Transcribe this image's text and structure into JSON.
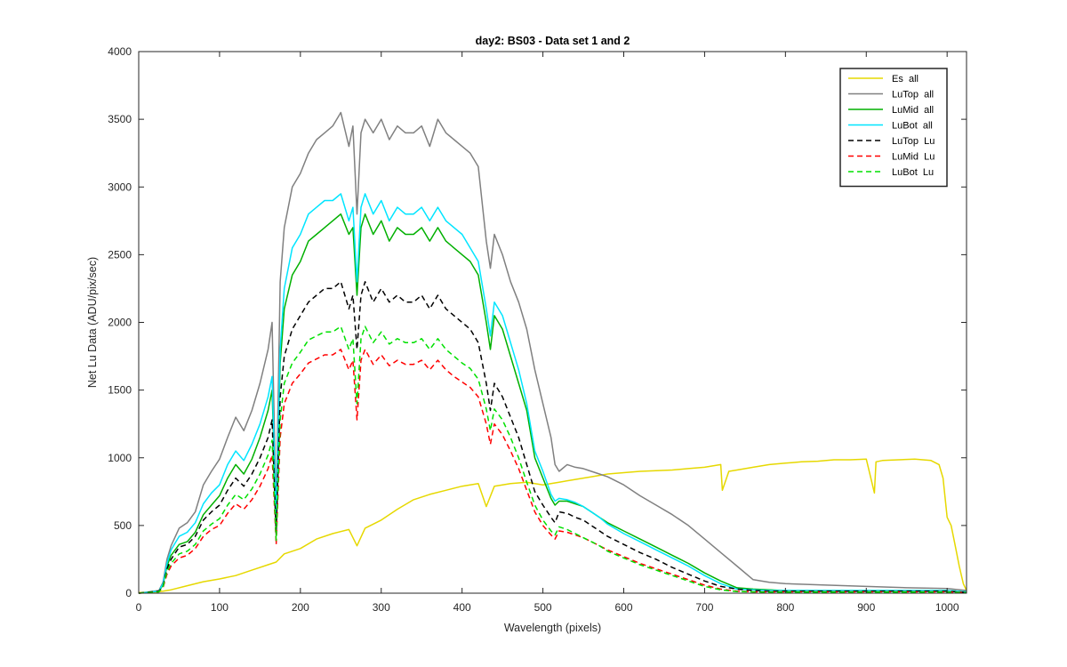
{
  "chart_data": {
    "type": "line",
    "title": "day2: BS03 - Data set 1 and 2",
    "xlabel": "Wavelength (pixels)",
    "ylabel": "Net Lu Data (ADU/pix/sec)",
    "xlim": [
      0,
      1024
    ],
    "ylim": [
      0,
      4000
    ],
    "xticks": [
      0,
      100,
      200,
      300,
      400,
      500,
      600,
      700,
      800,
      900,
      1000
    ],
    "yticks": [
      0,
      500,
      1000,
      1500,
      2000,
      2500,
      3000,
      3500,
      4000
    ],
    "grid": false,
    "legend_position": "top-right",
    "series": [
      {
        "name": "Es  all",
        "color": "#E6D800",
        "dash": "solid",
        "x": [
          0,
          20,
          30,
          40,
          60,
          80,
          100,
          120,
          140,
          160,
          170,
          180,
          200,
          220,
          240,
          260,
          270,
          280,
          300,
          320,
          340,
          360,
          380,
          400,
          420,
          430,
          440,
          460,
          480,
          500,
          520,
          540,
          560,
          580,
          600,
          620,
          640,
          660,
          680,
          700,
          720,
          722,
          730,
          740,
          760,
          780,
          800,
          820,
          840,
          860,
          880,
          900,
          910,
          912,
          920,
          940,
          960,
          980,
          990,
          995,
          1000,
          1005,
          1010,
          1015,
          1020,
          1024
        ],
        "y": [
          5,
          8,
          15,
          25,
          55,
          85,
          105,
          130,
          170,
          210,
          230,
          290,
          330,
          400,
          440,
          470,
          350,
          480,
          540,
          620,
          690,
          730,
          760,
          790,
          810,
          640,
          790,
          810,
          820,
          800,
          820,
          840,
          860,
          880,
          890,
          900,
          905,
          910,
          920,
          930,
          950,
          760,
          900,
          910,
          930,
          950,
          960,
          970,
          975,
          985,
          985,
          990,
          740,
          970,
          980,
          985,
          990,
          980,
          950,
          850,
          560,
          500,
          350,
          200,
          70,
          20
        ]
      },
      {
        "name": "LuTop  all",
        "color": "#808080",
        "dash": "solid",
        "x": [
          0,
          25,
          30,
          35,
          40,
          50,
          60,
          70,
          80,
          90,
          100,
          110,
          120,
          130,
          140,
          150,
          160,
          165,
          170,
          175,
          180,
          190,
          200,
          210,
          220,
          230,
          240,
          250,
          260,
          265,
          270,
          275,
          280,
          290,
          300,
          310,
          320,
          330,
          340,
          350,
          360,
          370,
          380,
          390,
          400,
          410,
          420,
          430,
          435,
          440,
          450,
          460,
          470,
          480,
          490,
          500,
          510,
          515,
          520,
          530,
          540,
          550,
          560,
          570,
          580,
          600,
          620,
          640,
          660,
          680,
          700,
          720,
          740,
          760,
          780,
          800,
          850,
          900,
          950,
          1000,
          1024
        ],
        "y": [
          0,
          20,
          80,
          250,
          350,
          480,
          520,
          600,
          800,
          900,
          990,
          1150,
          1300,
          1200,
          1350,
          1550,
          1800,
          2000,
          600,
          2300,
          2700,
          3000,
          3100,
          3250,
          3350,
          3400,
          3450,
          3550,
          3300,
          3450,
          2800,
          3400,
          3500,
          3400,
          3500,
          3350,
          3450,
          3400,
          3400,
          3450,
          3300,
          3500,
          3400,
          3350,
          3300,
          3250,
          3150,
          2600,
          2400,
          2650,
          2500,
          2300,
          2150,
          1950,
          1650,
          1400,
          1150,
          950,
          900,
          950,
          930,
          920,
          900,
          880,
          860,
          800,
          720,
          650,
          580,
          500,
          400,
          300,
          200,
          100,
          80,
          70,
          60,
          50,
          40,
          35,
          20
        ]
      },
      {
        "name": "LuMid  all",
        "color": "#00B000",
        "dash": "solid",
        "x": [
          0,
          25,
          30,
          35,
          40,
          50,
          60,
          70,
          80,
          90,
          100,
          110,
          120,
          130,
          140,
          150,
          160,
          165,
          170,
          175,
          180,
          190,
          200,
          210,
          220,
          230,
          240,
          250,
          260,
          265,
          270,
          275,
          280,
          290,
          300,
          310,
          320,
          330,
          340,
          350,
          360,
          370,
          380,
          390,
          400,
          410,
          420,
          430,
          435,
          440,
          450,
          460,
          470,
          480,
          490,
          500,
          510,
          515,
          520,
          530,
          540,
          550,
          560,
          570,
          580,
          600,
          620,
          640,
          660,
          680,
          700,
          720,
          740,
          760,
          780,
          800,
          850,
          900,
          950,
          1000,
          1024
        ],
        "y": [
          0,
          15,
          60,
          200,
          280,
          360,
          380,
          450,
          580,
          650,
          720,
          850,
          950,
          880,
          990,
          1150,
          1350,
          1500,
          500,
          1700,
          2100,
          2350,
          2450,
          2600,
          2650,
          2700,
          2750,
          2800,
          2650,
          2700,
          2200,
          2700,
          2800,
          2650,
          2750,
          2600,
          2700,
          2650,
          2650,
          2700,
          2600,
          2700,
          2600,
          2550,
          2500,
          2450,
          2350,
          2000,
          1800,
          2050,
          1950,
          1750,
          1550,
          1350,
          1000,
          850,
          700,
          650,
          680,
          680,
          660,
          640,
          600,
          560,
          520,
          460,
          400,
          340,
          280,
          220,
          150,
          90,
          40,
          30,
          25,
          20,
          20,
          20,
          20,
          20,
          10
        ]
      },
      {
        "name": "LuBot  all",
        "color": "#00E5FF",
        "dash": "solid",
        "x": [
          0,
          25,
          30,
          35,
          40,
          50,
          60,
          70,
          80,
          90,
          100,
          110,
          120,
          130,
          140,
          150,
          160,
          165,
          170,
          175,
          180,
          190,
          200,
          210,
          220,
          230,
          240,
          250,
          260,
          265,
          270,
          275,
          280,
          290,
          300,
          310,
          320,
          330,
          340,
          350,
          360,
          370,
          380,
          390,
          400,
          410,
          420,
          430,
          435,
          440,
          450,
          460,
          470,
          480,
          490,
          500,
          510,
          515,
          520,
          530,
          540,
          550,
          560,
          570,
          580,
          600,
          620,
          640,
          660,
          680,
          700,
          720,
          740,
          760,
          780,
          800,
          850,
          900,
          950,
          1000,
          1024
        ],
        "y": [
          0,
          15,
          70,
          220,
          320,
          420,
          450,
          520,
          660,
          740,
          800,
          950,
          1050,
          980,
          1100,
          1250,
          1450,
          1600,
          550,
          1800,
          2250,
          2550,
          2650,
          2800,
          2850,
          2900,
          2900,
          2950,
          2750,
          2850,
          2300,
          2850,
          2950,
          2800,
          2900,
          2750,
          2850,
          2800,
          2800,
          2850,
          2750,
          2850,
          2750,
          2700,
          2650,
          2550,
          2450,
          2100,
          1900,
          2150,
          2050,
          1850,
          1650,
          1400,
          1050,
          900,
          730,
          680,
          700,
          690,
          670,
          640,
          600,
          560,
          510,
          440,
          380,
          320,
          260,
          200,
          130,
          70,
          30,
          25,
          20,
          20,
          20,
          20,
          20,
          20,
          10
        ]
      },
      {
        "name": "LuTop  Lu",
        "color": "#000000",
        "dash": "dashed",
        "x": [
          0,
          25,
          30,
          35,
          40,
          50,
          60,
          70,
          80,
          90,
          100,
          110,
          120,
          130,
          140,
          150,
          160,
          165,
          170,
          175,
          180,
          190,
          200,
          210,
          220,
          230,
          240,
          250,
          260,
          265,
          270,
          275,
          280,
          290,
          300,
          310,
          320,
          330,
          340,
          350,
          360,
          370,
          380,
          390,
          400,
          410,
          420,
          430,
          435,
          440,
          450,
          460,
          470,
          480,
          490,
          500,
          510,
          515,
          520,
          530,
          540,
          550,
          560,
          570,
          580,
          600,
          620,
          640,
          660,
          680,
          700,
          720,
          740,
          760,
          780,
          800,
          850,
          900,
          950,
          1000,
          1024
        ],
        "y": [
          0,
          15,
          50,
          180,
          250,
          340,
          360,
          420,
          540,
          600,
          650,
          760,
          850,
          790,
          880,
          1000,
          1150,
          1280,
          430,
          1450,
          1750,
          1950,
          2050,
          2150,
          2200,
          2250,
          2250,
          2300,
          2100,
          2200,
          1800,
          2200,
          2300,
          2150,
          2250,
          2150,
          2200,
          2150,
          2150,
          2200,
          2100,
          2200,
          2100,
          2050,
          2000,
          1950,
          1850,
          1550,
          1350,
          1550,
          1450,
          1300,
          1150,
          950,
          750,
          650,
          560,
          520,
          600,
          590,
          560,
          540,
          500,
          460,
          420,
          360,
          300,
          250,
          190,
          140,
          90,
          50,
          30,
          20,
          15,
          15,
          15,
          15,
          15,
          15,
          5
        ]
      },
      {
        "name": "LuMid  Lu",
        "color": "#FF0000",
        "dash": "dashed",
        "x": [
          0,
          25,
          30,
          35,
          40,
          50,
          60,
          70,
          80,
          90,
          100,
          110,
          120,
          130,
          140,
          150,
          160,
          165,
          170,
          175,
          180,
          190,
          200,
          210,
          220,
          230,
          240,
          250,
          260,
          265,
          270,
          275,
          280,
          290,
          300,
          310,
          320,
          330,
          340,
          350,
          360,
          370,
          380,
          390,
          400,
          410,
          420,
          430,
          435,
          440,
          450,
          460,
          470,
          480,
          490,
          500,
          510,
          515,
          520,
          530,
          540,
          550,
          560,
          570,
          580,
          600,
          620,
          640,
          660,
          680,
          700,
          720,
          740,
          760,
          780,
          800,
          850,
          900,
          950,
          1000,
          1024
        ],
        "y": [
          0,
          10,
          40,
          140,
          200,
          260,
          280,
          330,
          420,
          470,
          500,
          590,
          660,
          620,
          690,
          790,
          920,
          1020,
          360,
          1150,
          1400,
          1550,
          1620,
          1700,
          1730,
          1760,
          1760,
          1800,
          1650,
          1720,
          1280,
          1720,
          1800,
          1690,
          1760,
          1680,
          1720,
          1690,
          1690,
          1720,
          1650,
          1720,
          1650,
          1600,
          1560,
          1520,
          1450,
          1250,
          1100,
          1250,
          1170,
          1050,
          920,
          760,
          600,
          500,
          430,
          400,
          460,
          450,
          430,
          410,
          380,
          350,
          320,
          270,
          220,
          180,
          140,
          100,
          60,
          30,
          15,
          10,
          10,
          10,
          10,
          10,
          10,
          10,
          5
        ]
      },
      {
        "name": "LuBot  Lu",
        "color": "#00E000",
        "dash": "dashed",
        "x": [
          0,
          25,
          30,
          35,
          40,
          50,
          60,
          70,
          80,
          90,
          100,
          110,
          120,
          130,
          140,
          150,
          160,
          165,
          170,
          175,
          180,
          190,
          200,
          210,
          220,
          230,
          240,
          250,
          260,
          265,
          270,
          275,
          280,
          290,
          300,
          310,
          320,
          330,
          340,
          350,
          360,
          370,
          380,
          390,
          400,
          410,
          420,
          430,
          435,
          440,
          450,
          460,
          470,
          480,
          490,
          500,
          510,
          515,
          520,
          530,
          540,
          550,
          560,
          570,
          580,
          600,
          620,
          640,
          660,
          680,
          700,
          720,
          740,
          760,
          780,
          800,
          850,
          900,
          950,
          1000,
          1024
        ],
        "y": [
          0,
          10,
          45,
          160,
          220,
          290,
          310,
          360,
          460,
          510,
          550,
          650,
          730,
          690,
          770,
          880,
          1020,
          1130,
          390,
          1280,
          1550,
          1700,
          1780,
          1870,
          1900,
          1930,
          1930,
          1970,
          1800,
          1880,
          1400,
          1880,
          1970,
          1850,
          1930,
          1840,
          1880,
          1850,
          1850,
          1880,
          1800,
          1880,
          1800,
          1750,
          1700,
          1660,
          1580,
          1360,
          1200,
          1360,
          1280,
          1150,
          1000,
          820,
          650,
          540,
          460,
          430,
          490,
          470,
          440,
          410,
          380,
          350,
          310,
          260,
          210,
          170,
          130,
          90,
          50,
          25,
          12,
          10,
          8,
          8,
          8,
          8,
          8,
          8,
          4
        ]
      }
    ]
  }
}
